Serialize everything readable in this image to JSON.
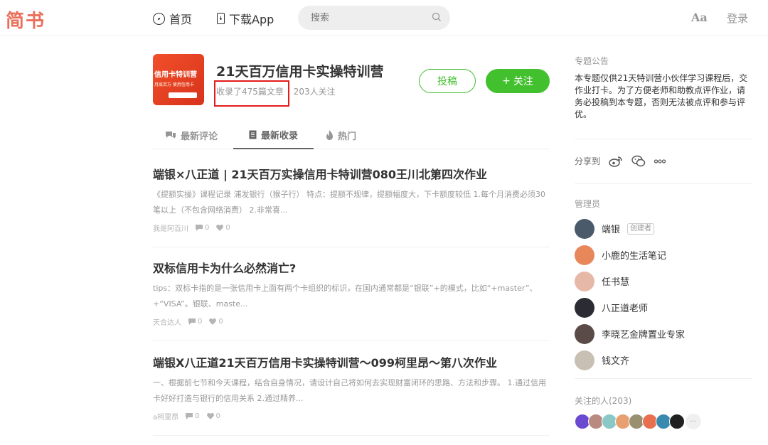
{
  "nav": {
    "logo": "简书",
    "home": "首页",
    "app": "下载App",
    "search_placeholder": "搜索",
    "font_toggle": "Aa",
    "login": "登录"
  },
  "collection": {
    "cover_title": "信用卡特训营",
    "cover_sub": "月底百万 使用信用卡",
    "title": "21天百万信用卡实操特训营",
    "articles_count": "收录了475篇文章",
    "followers_count": "203人关注",
    "contribute": "投稿",
    "follow": "关注",
    "follow_plus": "+"
  },
  "tabs": [
    {
      "label": "最新评论",
      "icon": "comment-icon"
    },
    {
      "label": "最新收录",
      "icon": "document-icon"
    },
    {
      "label": "热门",
      "icon": "fire-icon"
    }
  ],
  "articles": [
    {
      "title": "端银×八正道 | 21天百万实操信用卡特训营080王川北第四次作业",
      "abstract": "《提额实操》课程记录 浦发银行（猴子行） 特点：提额不规律，提额幅度大，下卡额度较低 1.每个月消费必须30笔以上（不包含网络消费） 2.非常喜...",
      "author": "我是阿百川",
      "comments": "0",
      "likes": "0"
    },
    {
      "title": "双标信用卡为什么必然消亡?",
      "abstract": "tips：双标卡指的是一张信用卡上面有两个卡组织的标识，在国内通常都是“银联”+的模式，比如“+master”、+“VISA”。银联、maste...",
      "author": "天合达人",
      "comments": "0",
      "likes": "0"
    },
    {
      "title": "端银X八正道21天百万信用卡实操特训营～099柯里昂～第八次作业",
      "abstract": "一、根据前七节和今天课程，结合自身情况，请设计自己将如何去实现财富闭环的思路、方法和步骤。 1.通过信用卡好好打造与银行的信用关系 2.通过精养...",
      "author": "a柯里昂",
      "comments": "0",
      "likes": "0"
    }
  ],
  "sidebar": {
    "notice_label": "专题公告",
    "notice": "本专题仅供21天特训营小伙伴学习课程后，交作业打卡。为了方便老师和助教点评作业，请务必投稿到本专题，否则无法被点评和参与评优。",
    "share_label": "分享到",
    "admins_label": "管理员",
    "admins": [
      {
        "name": "端银",
        "badge": "创建者",
        "color": "#4a5a6a"
      },
      {
        "name": "小鹿的生活笔记",
        "badge": "",
        "color": "#e8875a"
      },
      {
        "name": "任书慧",
        "badge": "",
        "color": "#e6b8a8"
      },
      {
        "name": "八正道老师",
        "badge": "",
        "color": "#2b2b33"
      },
      {
        "name": "李晓艺金牌置业专家",
        "badge": "",
        "color": "#5a4a48"
      },
      {
        "name": "钱文齐",
        "badge": "",
        "color": "#c9c0b4"
      }
    ],
    "followers_label": "关注的人(203)",
    "follower_colors": [
      "#6a4ad0",
      "#b88a80",
      "#8ac8c8",
      "#e8a070",
      "#9a9070",
      "#e87050",
      "#3a8ab0",
      "#202020"
    ],
    "more": "···"
  }
}
